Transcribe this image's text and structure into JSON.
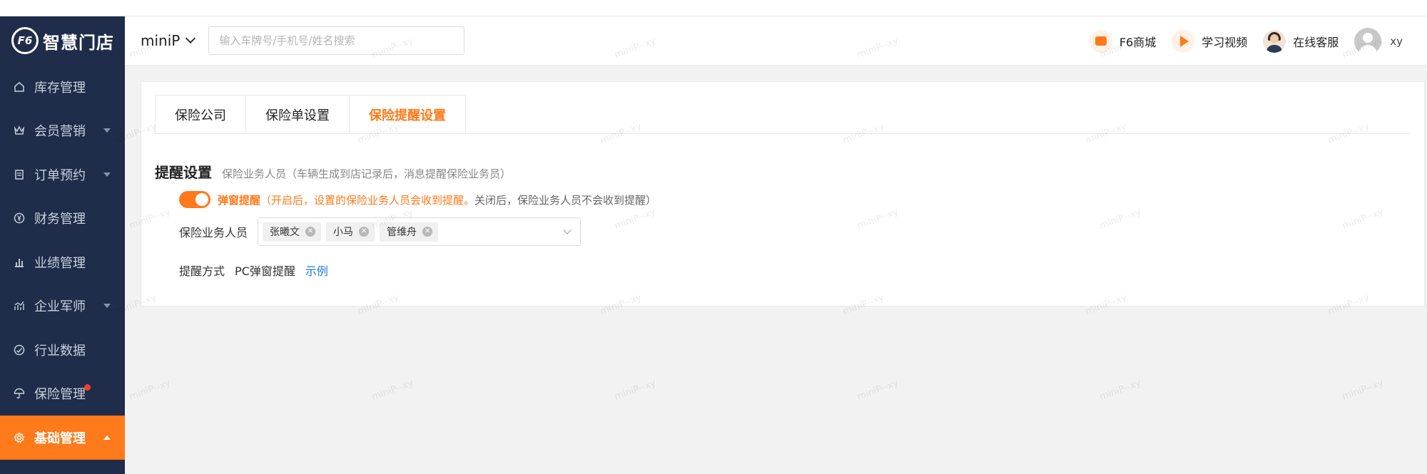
{
  "sidebar": {
    "brand": "智慧门店",
    "items": [
      {
        "label": "库存管理",
        "icon": "home-icon",
        "caret": false
      },
      {
        "label": "会员营销",
        "icon": "crown-icon",
        "caret": true
      },
      {
        "label": "订单预约",
        "icon": "clipboard-icon",
        "caret": true
      },
      {
        "label": "财务管理",
        "icon": "yen-icon",
        "caret": false
      },
      {
        "label": "业绩管理",
        "icon": "bar-chart-icon",
        "caret": false
      },
      {
        "label": "企业军师",
        "icon": "trend-icon",
        "caret": true
      },
      {
        "label": "行业数据",
        "icon": "gauge-icon",
        "caret": false
      },
      {
        "label": "保险管理",
        "icon": "umbrella-icon",
        "caret": false,
        "badge_dot": true
      },
      {
        "label": "基础管理",
        "icon": "gear-icon",
        "caret": true,
        "active": true
      }
    ]
  },
  "header": {
    "store_name": "miniP",
    "search_placeholder": "输入车牌号/手机号/姓名搜索",
    "links": {
      "mall": "F6商城",
      "video": "学习视频",
      "service": "在线客服"
    },
    "username": "xy"
  },
  "tabs": [
    {
      "label": "保险公司",
      "active": false
    },
    {
      "label": "保险单设置",
      "active": false
    },
    {
      "label": "保险提醒设置",
      "active": true
    }
  ],
  "reminder": {
    "title": "提醒设置",
    "description": "保险业务人员（车辆生成到店记录后，消息提醒保险业务员）",
    "toggle_label": "弹窗提醒",
    "toggle_on": true,
    "hint_on": "（开启后，设置的保险业务人员会收到提醒。",
    "hint_off": "关闭后，保险业务人员不会收到提醒）",
    "staff_label": "保险业务人员",
    "staff": [
      "张曦文",
      "小马",
      "管维舟"
    ],
    "method_label": "提醒方式",
    "method_value": "PC弹窗提醒",
    "example_link": "示例"
  },
  "watermark": "miniP--xy",
  "colors": {
    "accent": "#ff7a1a",
    "sidebar_bg": "#1f2d4a",
    "link": "#1f7ae0"
  }
}
